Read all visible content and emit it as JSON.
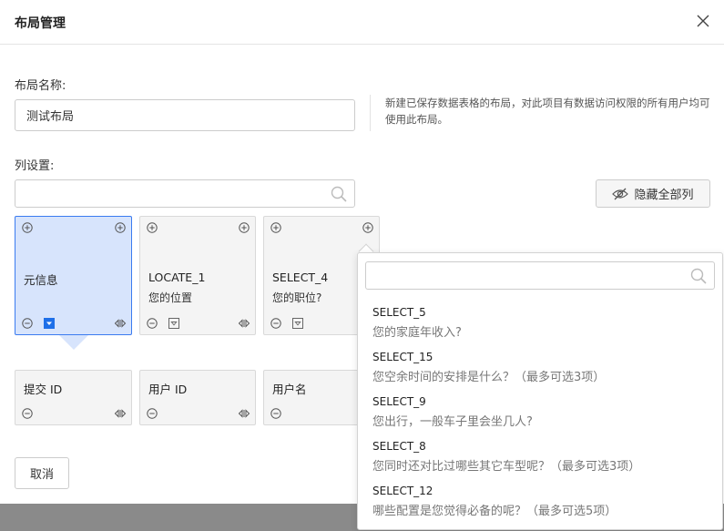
{
  "dialog": {
    "title": "布局管理",
    "layout_name_label": "布局名称:",
    "layout_name_value": "测试布局",
    "help_text": "新建已保存数据表格的布局，对此项目有数据访问权限的所有用户均可使用此布局。",
    "column_settings_label": "列设置:",
    "column_search_placeholder": "",
    "hide_all_label": "隐藏全部列",
    "cancel_label": "取消"
  },
  "cards": [
    {
      "title": "元信息",
      "subtitle": ""
    },
    {
      "title": "LOCATE_1",
      "subtitle": "您的位置"
    },
    {
      "title": "SELECT_4",
      "subtitle": "您的职位?"
    },
    {
      "title": "提交 ID",
      "subtitle": ""
    },
    {
      "title": "用户 ID",
      "subtitle": ""
    },
    {
      "title": "用户名",
      "subtitle": ""
    }
  ],
  "dropdown": {
    "search_placeholder": "",
    "items": [
      {
        "code": "SELECT_5",
        "question": "您的家庭年收入?"
      },
      {
        "code": "SELECT_15",
        "question": "您空余时间的安排是什么？（最多可选3项）"
      },
      {
        "code": "SELECT_9",
        "question": "您出行，一般车子里会坐几人?"
      },
      {
        "code": "SELECT_8",
        "question": "您同时还对比过哪些其它车型呢？（最多可选3项）"
      },
      {
        "code": "SELECT_12",
        "question": "哪些配置是您觉得必备的呢？（最多可选5项）"
      }
    ]
  },
  "colors": {
    "selected_card_bg": "#d7e4fc",
    "selected_card_border": "#3b7bf0",
    "card_bg": "#f4f4f4",
    "accent": "#1e6fe8"
  }
}
